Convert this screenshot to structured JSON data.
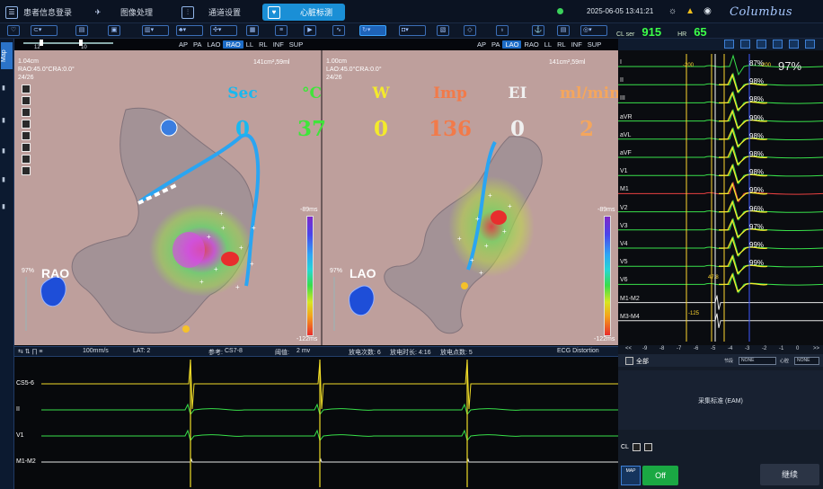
{
  "menu": {
    "patient_login": "患者信息登录",
    "image_processing": "图像处理",
    "channel_settings": "通道设置",
    "cardiac_mapping": "心脏标测"
  },
  "datetime": "2025-06-05 13:41:21",
  "brand": "Columbus",
  "vitals": {
    "cl_label": "CL ser",
    "cl_value": "915",
    "hr_label": "HR",
    "hr_value": "65"
  },
  "slider": {
    "left": "12",
    "right": "10"
  },
  "views": {
    "tabs": [
      "AP",
      "PA",
      "LAO",
      "RAO",
      "LL",
      "RL",
      "INF",
      "SUP"
    ],
    "left": {
      "active_tab": "RAO",
      "info": [
        "1.04cm",
        "RAO:45.0°CRA:0.0°",
        "24/26"
      ],
      "area": "141cm²,59ml",
      "name": "RAO",
      "scale_top": "-89ms",
      "scale_bottom": "-122ms",
      "percent": "97%"
    },
    "right": {
      "active_tab": "LAO",
      "info": [
        "1.00cm",
        "LAO:45.0°CRA:0.0°",
        "24/26"
      ],
      "area": "141cm²,59ml",
      "name": "LAO",
      "scale_top": "-89ms",
      "scale_bottom": "-122ms",
      "percent": "97%"
    }
  },
  "ablation": {
    "labels": [
      "Sec",
      "°C",
      "W",
      "Imp",
      "EI",
      "ml/min"
    ],
    "values": [
      "0",
      "37",
      "0",
      "136",
      "0",
      "2"
    ],
    "colors": [
      "#19b8ef",
      "#3fe53a",
      "#f3ea2b",
      "#f27a49",
      "#f0f0f0",
      "#f4a65d"
    ]
  },
  "ecg_panel": {
    "leads": [
      "I",
      "II",
      "III",
      "aVR",
      "aVL",
      "aVF",
      "V1",
      "M1",
      "V2",
      "V3",
      "V4",
      "V5",
      "V6",
      "M1-M2",
      "M3-M4"
    ],
    "percentages": [
      "87%",
      "98%",
      "98%",
      "99%",
      "98%",
      "98%",
      "98%",
      "99%",
      "96%",
      "97%",
      "99%",
      "99%"
    ],
    "big_percent": "97%",
    "marker_neg200_left": "-200",
    "marker_neg200_right": "-200",
    "marker_neg125": "-125",
    "marker_47": "47.8",
    "ticks": [
      "<<",
      "-9",
      "-8",
      "-7",
      "-6",
      "-5",
      "-4",
      "-3",
      "-2",
      "-1",
      "0",
      ">>"
    ]
  },
  "bottom": {
    "speed": "100mm/s",
    "lat": "LAT: 2",
    "ref_label": "参考:",
    "ref_value": "CS7-8",
    "thresh_label": "阈值:",
    "thresh_value": "2 mv",
    "discharge_count": "放电次数: 6",
    "discharge_time": "放电时长: 4:16",
    "discharge_points": "放电点数: 5",
    "ecg_distortion": "ECG Distortion"
  },
  "strips": {
    "leads": [
      "CS5-6",
      "II",
      "V1",
      "M1-M2"
    ]
  },
  "right_bottom": {
    "all": "全部",
    "sel1_label": "节段",
    "sel1_value": "NONE",
    "sel2_label": "心腔",
    "sel2_value": "NONE",
    "std": "采集标准 (EAM)",
    "cl": "CL",
    "map": "MAP",
    "off": "Off",
    "continue": "继续"
  }
}
